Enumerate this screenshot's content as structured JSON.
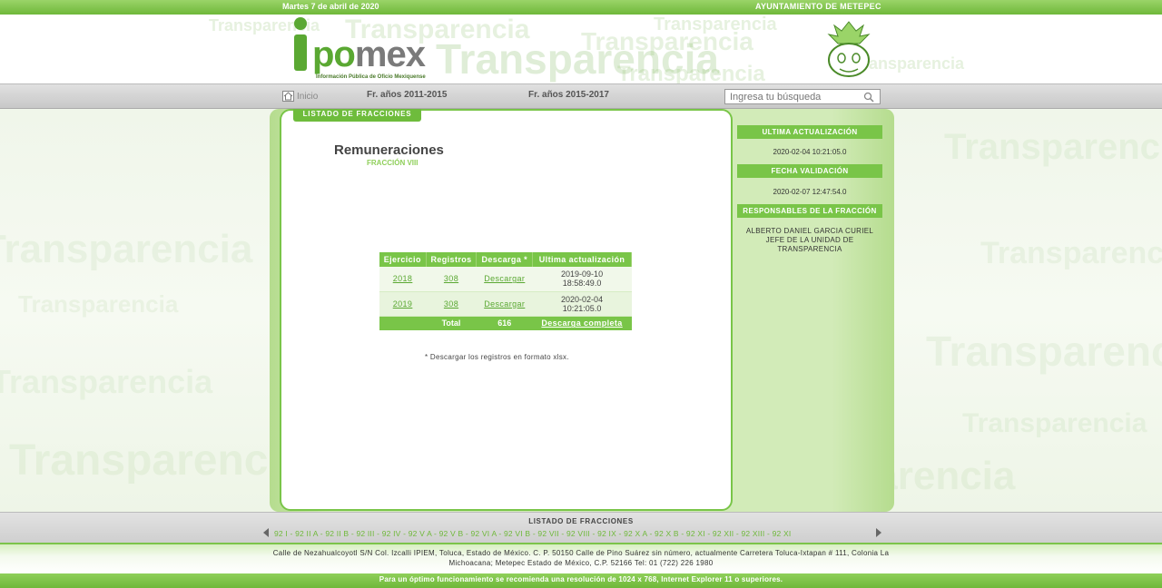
{
  "topbar": {
    "date": "Martes 7 de abril de 2020",
    "municipality": "AYUNTAMIENTO DE METEPEC"
  },
  "header": {
    "logo_po": "po",
    "logo_mex": "mex",
    "logo_subtitle": "Información Pública de Oficio Mexiquense",
    "watermark_word": "Transparencia"
  },
  "nav": {
    "home_label": "Inicio",
    "link_2011": "Fr. años 2011-2015",
    "link_2015": "Fr. años 2015-2017",
    "search_placeholder": "Ingresa tu búsqueda"
  },
  "content": {
    "tab_label": "LISTADO DE FRACCIONES",
    "title": "Remuneraciones",
    "subtitle": "FRACCIÓN VIII",
    "table": {
      "headers": [
        "Ejercicio",
        "Registros",
        "Descarga *",
        "Ultima actualización"
      ],
      "rows": [
        {
          "year": "2018",
          "records": "308",
          "download": "Descargar",
          "updated_date": "2019-09-10",
          "updated_time": "18:58:49.0"
        },
        {
          "year": "2019",
          "records": "308",
          "download": "Descargar",
          "updated_date": "2020-02-04",
          "updated_time": "10:21:05.0"
        }
      ],
      "total_label": "Total",
      "total_value": "616",
      "full_download": "Descarga completa"
    },
    "note": "* Descargar los registros en formato xlsx."
  },
  "sidebar": {
    "last_update_label": "ULTIMA ACTUALIZACIÓN",
    "last_update_value": "2020-02-04 10:21:05.0",
    "validation_label": "FECHA VALIDACIÓN",
    "validation_value": "2020-02-07 12:47:54.0",
    "responsible_label": "RESPONSABLES DE LA FRACCIÓN",
    "responsible_name": "ALBERTO DANIEL GARCIA CURIEL",
    "responsible_role": "JEFE DE LA UNIDAD DE TRANSPARENCIA"
  },
  "fracbar": {
    "title": "LISTADO DE FRACCIONES",
    "list": "92 I - 92 II A - 92 II B - 92 III - 92 IV - 92 V A - 92 V B - 92 VI A - 92 VI B - 92 VII - 92 VIII - 92 IX - 92 X A - 92 X B - 92 XI - 92 XII - 92 XIII - 92 XI"
  },
  "footer": {
    "address": "Calle de Nezahualcoyotl S/N Col. Izcalli IPIEM, Toluca, Estado de México. C. P. 50150 Calle de Pino Suárez sin número, actualmente Carretera Toluca-Ixtapan # 111, Colonia La Michoacana; Metepec Estado de México, C.P. 52166 Tel: 01 (722) 226 1980",
    "recommendation": "Para un óptimo funcionamiento se recomienda una resolución de 1024 x 768, Internet Explorer 11 o superiores."
  },
  "colors": {
    "brand_green": "#79c548",
    "dark_green": "#5aa832",
    "gray_nav": "#cfcfcf"
  }
}
